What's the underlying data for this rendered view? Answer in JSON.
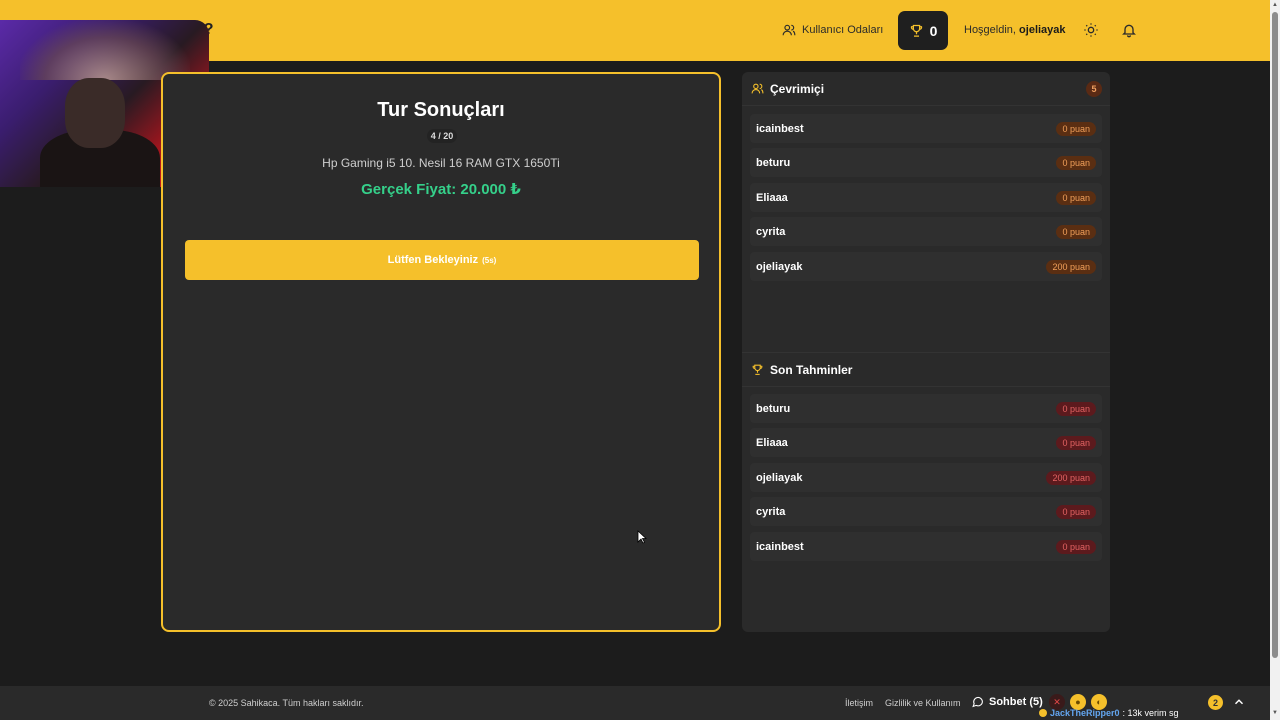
{
  "header": {
    "brand": "ca?",
    "rooms_label": "Kullanıcı Odaları",
    "score": "0",
    "welcome_prefix": "Hoşgeldin,",
    "username": "ojeliayak"
  },
  "game": {
    "title": "Tur Sonuçları",
    "round": "4 / 20",
    "product": "Hp Gaming i5 10. Nesil 16 RAM GTX 1650Ti",
    "real_price": "Gerçek Fiyat: 20.000 ₺",
    "wait_label": "Lütfen Bekleyiniz",
    "wait_timer": "(5s)"
  },
  "online": {
    "title": "Çevrimiçi",
    "count": "5",
    "players": [
      {
        "name": "icainbest",
        "points": "0 puan"
      },
      {
        "name": "beturu",
        "points": "0 puan"
      },
      {
        "name": "Eliaaa",
        "points": "0 puan"
      },
      {
        "name": "cyrita",
        "points": "0 puan"
      },
      {
        "name": "ojeliayak",
        "points": "200 puan"
      }
    ]
  },
  "guesses": {
    "title": "Son Tahminler",
    "items": [
      {
        "name": "beturu",
        "points": "0 puan"
      },
      {
        "name": "Eliaaa",
        "points": "0 puan"
      },
      {
        "name": "ojeliayak",
        "points": "200 puan"
      },
      {
        "name": "cyrita",
        "points": "0 puan"
      },
      {
        "name": "icainbest",
        "points": "0 puan"
      }
    ]
  },
  "footer": {
    "copyright": "© 2025 Sahikaca. Tüm hakları saklıdır.",
    "contact": "İletişim",
    "privacy": "Gizlilik ve Kullanım"
  },
  "chat": {
    "label": "Sohbet (5)",
    "unread": "2",
    "last_user": "JackTheRipper0",
    "last_message": ": 13k verim sg"
  },
  "colors": {
    "accent": "#f5c02b",
    "price_green": "#35d08a"
  }
}
